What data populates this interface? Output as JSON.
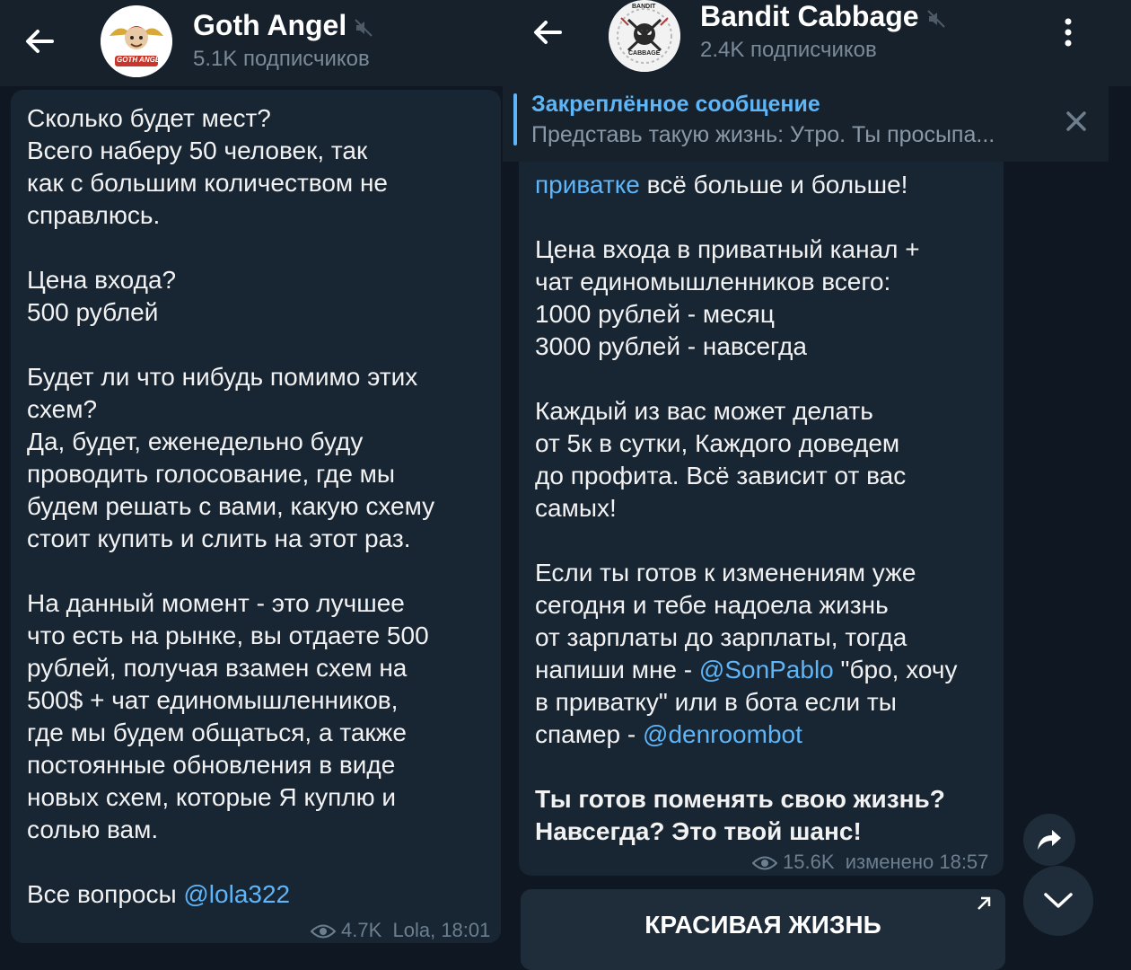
{
  "left": {
    "channel_name": "Goth Angel",
    "subscribers": "5.1K подписчиков",
    "avatar_text": "GOTH ANGEL",
    "message": {
      "paragraphs": [
        "Сколько будет мест?\nВсего наберу 50 человек, так\nкак с большим количеством не\nсправлюсь.",
        "Цена входа?\n500 рублей",
        "Будет ли что нибудь помимо этих\nсхем?\nДа, будет, еженедельно буду\nпроводить голосование, где мы\nбудем решать с вами, какую схему\nстоит купить и слить на этот раз.",
        "На данный момент - это лучшее\nчто есть на рынке, вы отдаете 500\nрублей, получая взамен схем на\n500$ + чат единомышленников,\nгде мы будем общаться, а также\nпостоянные обновления в виде\nновых схем, которые Я куплю и\nсолью вам."
      ],
      "last_prefix": "Все вопросы ",
      "last_link": "@lola322",
      "views": "4.7K",
      "author_time": "Lola, 18:01"
    }
  },
  "right": {
    "channel_name": "Bandit Cabbage",
    "subscribers": "2.4K подписчиков",
    "avatar_text_top": "BANDIT",
    "avatar_text_bottom": "CABBAGE",
    "pinned": {
      "title": "Закреплённое сообщение",
      "preview": "Представь такую жизнь:  Утро. Ты просыпа..."
    },
    "message": {
      "top_link": "приватке",
      "top_rest": " всё больше и больше!",
      "p_price": "Цена входа в приватный канал +\nчат единомышленников всего:\n1000 рублей - месяц\n3000 рублей - навсегда",
      "p_each": "Каждый из вас может делать\nот 5к в сутки, Каждого доведем\nдо профита. Всё зависит от вас\nсамых!",
      "p_ready_1": "Если ты готов к изменениям уже\nсегодня и тебе надоела жизнь\nот зарплаты до зарплаты, тогда\nнапиши мне - ",
      "link_sonpablo": "@SonPablo",
      "p_ready_2": " \"бро, хочу\nв приватку\" или в бота если ты\nспамер - ",
      "link_bot": "@denroombot",
      "p_final": "Ты готов поменять свою жизнь?\nНавсегда? Это твой шанс!",
      "views": "15.6K",
      "edited_time": "изменено 18:57"
    },
    "keyboard_button": "КРАСИВАЯ ЖИЗНЬ"
  },
  "colors": {
    "background": "#0e1621",
    "header": "#17212b",
    "bubble": "#182533",
    "link": "#5eb5f7",
    "muted_text": "#7b8a99"
  },
  "icons": [
    "back-arrow-icon",
    "mute-icon",
    "more-vert-icon",
    "close-icon",
    "eye-icon",
    "share-icon",
    "chevron-down-icon",
    "external-arrow-icon"
  ]
}
